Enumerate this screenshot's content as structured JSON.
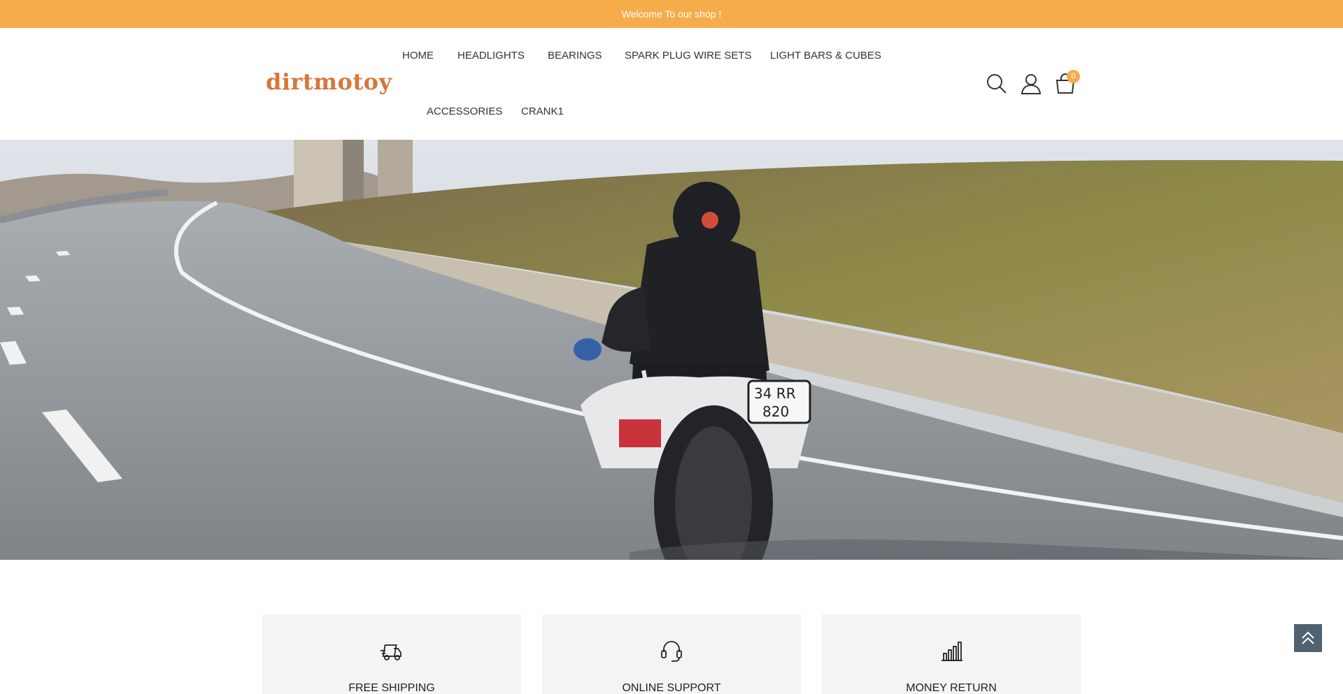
{
  "topbar": {
    "welcome": "Welcome To our shop !"
  },
  "header": {
    "logo": "dirtmotoy",
    "nav": [
      "HOME",
      "HEADLIGHTS",
      "BEARINGS",
      "SPARK PLUG WIRE SETS",
      "LIGHT BARS & CUBES",
      "ACCESSORIES",
      "CRANK1"
    ],
    "icons": [
      "search-icon",
      "user-icon",
      "cart-icon"
    ],
    "cart_count": "0"
  },
  "hero": {
    "image": "motorcyclist riding on highway curve"
  },
  "features": [
    {
      "icon": "truck-icon",
      "label": "FREE SHIPPING"
    },
    {
      "icon": "headset-icon",
      "label": "ONLINE SUPPORT"
    },
    {
      "icon": "bar-chart-icon",
      "label": "MONEY RETURN"
    }
  ],
  "scroll_top": {
    "icon": "double-chevron-up-icon"
  },
  "colors": {
    "accent": "#f7ac4b",
    "logo": "#d8763a",
    "scroll_button": "#4f6270",
    "feature_bg": "#f4f4f4"
  }
}
